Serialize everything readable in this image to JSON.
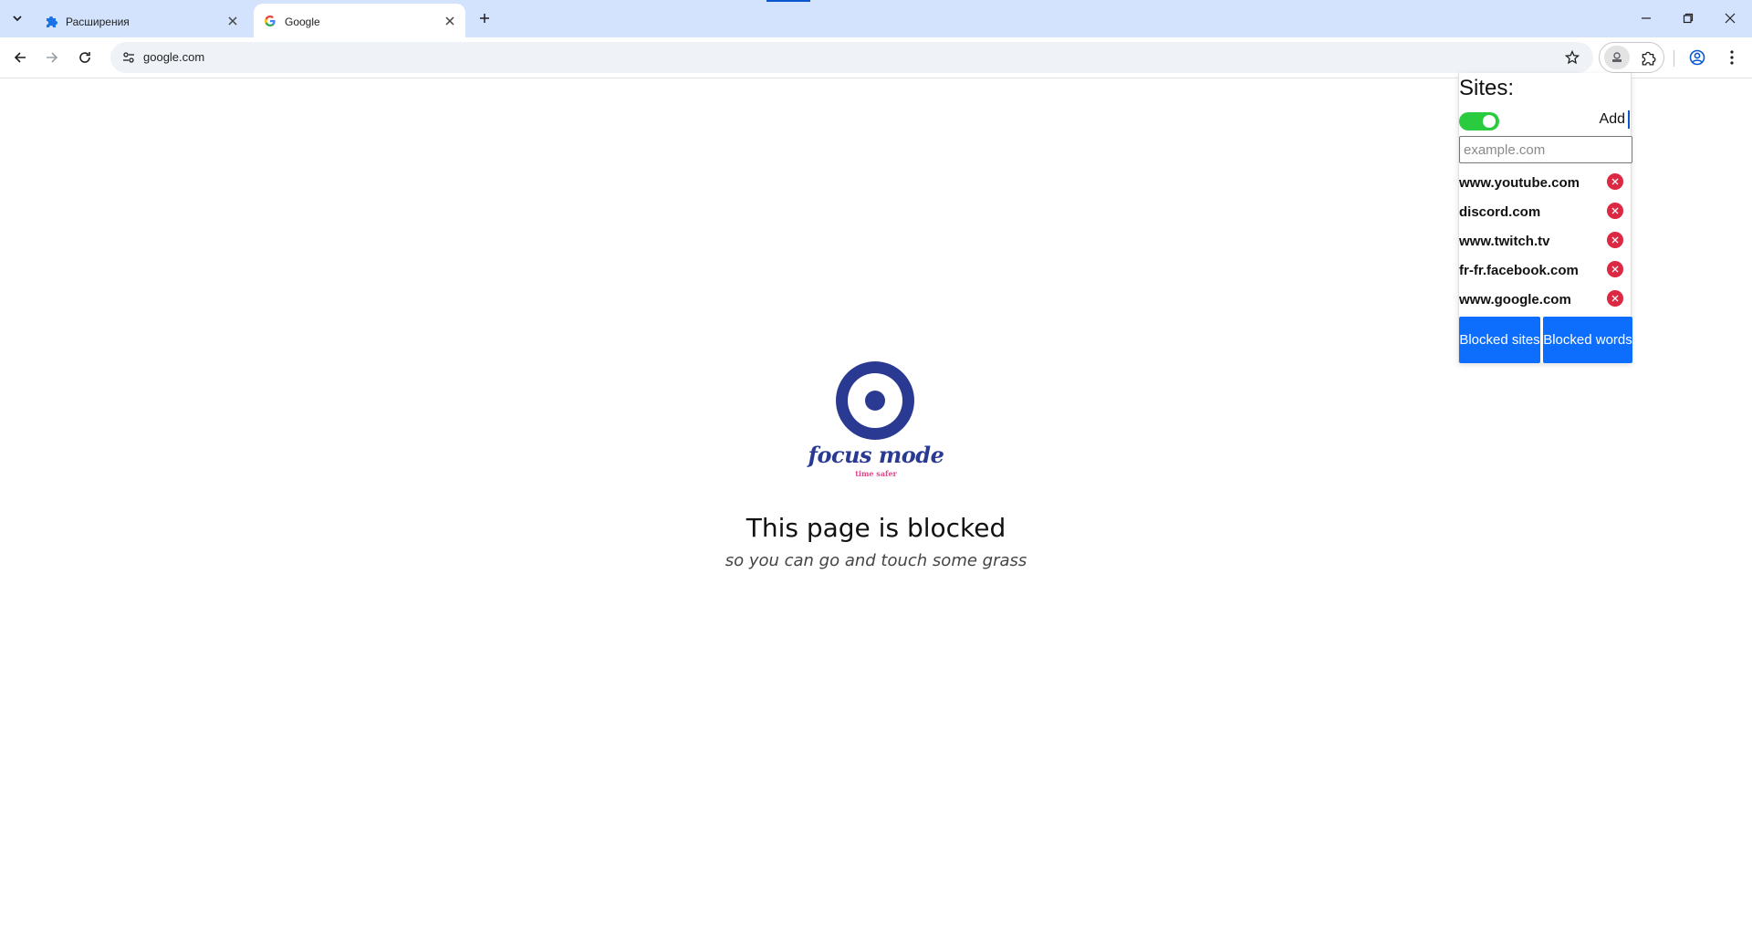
{
  "browser": {
    "tabs": [
      {
        "title": "Расширения",
        "icon": "puzzle-icon",
        "active": false
      },
      {
        "title": "Google",
        "icon": "google-g-icon",
        "active": true
      }
    ],
    "address": "google.com",
    "icons": {
      "tab_search": "chevron-down-icon",
      "new_tab": "plus-icon",
      "back": "back-arrow-icon",
      "forward": "forward-arrow-icon",
      "reload": "reload-icon",
      "site_info": "tune-icon",
      "bookmark": "star-icon",
      "extension_pinned": "focus-extension-icon",
      "extensions": "puzzle-icon",
      "profile": "profile-icon",
      "menu": "kebab-menu-icon"
    }
  },
  "blocked_page": {
    "logo_word": "focus mode",
    "logo_tagline": "time safer",
    "title": "This page is blocked",
    "subtitle": "so you can go and touch some grass"
  },
  "popup": {
    "heading": "Sites:",
    "toggle_on": true,
    "add_label": "Add",
    "input_placeholder": "example.com",
    "sites": [
      "www.youtube.com",
      "discord.com",
      "www.twitch.tv",
      "fr-fr.facebook.com",
      "www.google.com"
    ],
    "buttons": {
      "blocked_sites": "Blocked sites",
      "blocked_words": "Blocked words"
    }
  },
  "colors": {
    "tabstrip": "#d3e3fd",
    "toggle_on": "#2bcb3f",
    "delete": "#dc2843",
    "primary_button": "#0d6efd",
    "logo_navy": "#2a3a92",
    "logo_pink": "#e0468a"
  }
}
